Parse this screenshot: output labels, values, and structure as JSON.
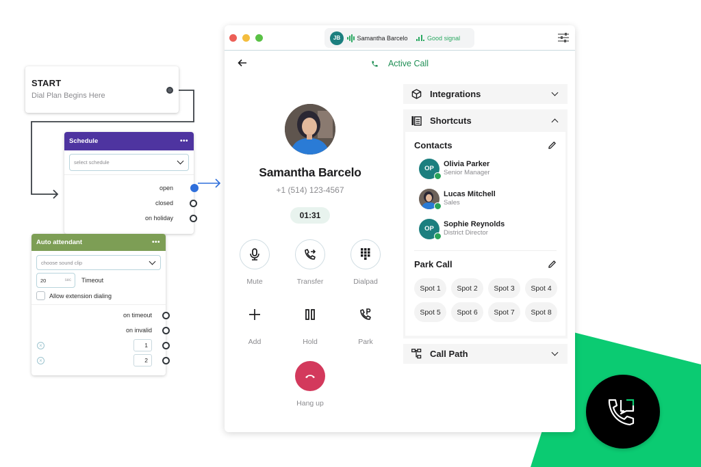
{
  "flow": {
    "start": {
      "title": "START",
      "subtitle": "Dial Plan Begins Here"
    },
    "schedule": {
      "title": "Schedule",
      "menu": "•••",
      "select_placeholder": "select schedule",
      "outputs": [
        {
          "label": "open",
          "connected": true
        },
        {
          "label": "closed",
          "connected": false
        },
        {
          "label": "on holiday",
          "connected": false
        }
      ]
    },
    "auto_attendant": {
      "title": "Auto attendant",
      "menu": "•••",
      "sound_placeholder": "choose sound clip",
      "timeout_value": "20",
      "timeout_unit": "sec",
      "timeout_label": "Timeout",
      "allow_extension_label": "Allow extension dialing",
      "allow_extension_checked": false,
      "outputs": [
        {
          "label": "on timeout"
        },
        {
          "label": "on invalid"
        }
      ],
      "digits": [
        "1",
        "2"
      ]
    }
  },
  "window": {
    "status_pill": {
      "initials": "JB",
      "caller_name": "Samantha Barcelo",
      "signal_text": "Good signal"
    },
    "header": {
      "title": "Active Call"
    },
    "caller": {
      "name": "Samantha Barcelo",
      "number": "+1 (514) 123-4567",
      "duration": "01:31"
    },
    "actions": [
      {
        "label": "Mute",
        "icon": "microphone-icon"
      },
      {
        "label": "Transfer",
        "icon": "transfer-icon"
      },
      {
        "label": "Dialpad",
        "icon": "dialpad-icon"
      },
      {
        "label": "Add",
        "icon": "plus-icon"
      },
      {
        "label": "Hold",
        "icon": "pause-icon"
      },
      {
        "label": "Park",
        "icon": "park-icon"
      }
    ],
    "hangup_label": "Hang up",
    "panel": {
      "integrations_label": "Integrations",
      "shortcuts_label": "Shortcuts",
      "contacts_label": "Contacts",
      "contacts": [
        {
          "initials": "OP",
          "name": "Olivia Parker",
          "role": "Senior Manager",
          "has_photo": false,
          "status": "online"
        },
        {
          "initials": "",
          "name": "Lucas Mitchell",
          "role": "Sales",
          "has_photo": true,
          "status": "online"
        },
        {
          "initials": "OP",
          "name": "Sophie Reynolds",
          "role": "District Director",
          "has_photo": false,
          "status": "online"
        }
      ],
      "park_call_label": "Park Call",
      "spots": [
        "Spot 1",
        "Spot 2",
        "Spot 3",
        "Spot 4",
        "Spot 5",
        "Spot 6",
        "Spot 7",
        "Spot 8"
      ],
      "call_path_label": "Call Path"
    }
  },
  "colors": {
    "brand_green": "#0bcb72",
    "active_green": "#1f8f55",
    "schedule_header": "#4e34a0",
    "attendant_header": "#7d9e55",
    "hangup_red": "#d3395c",
    "avatar_teal": "#1c7f7f",
    "connector_blue": "#2f6fdb"
  }
}
